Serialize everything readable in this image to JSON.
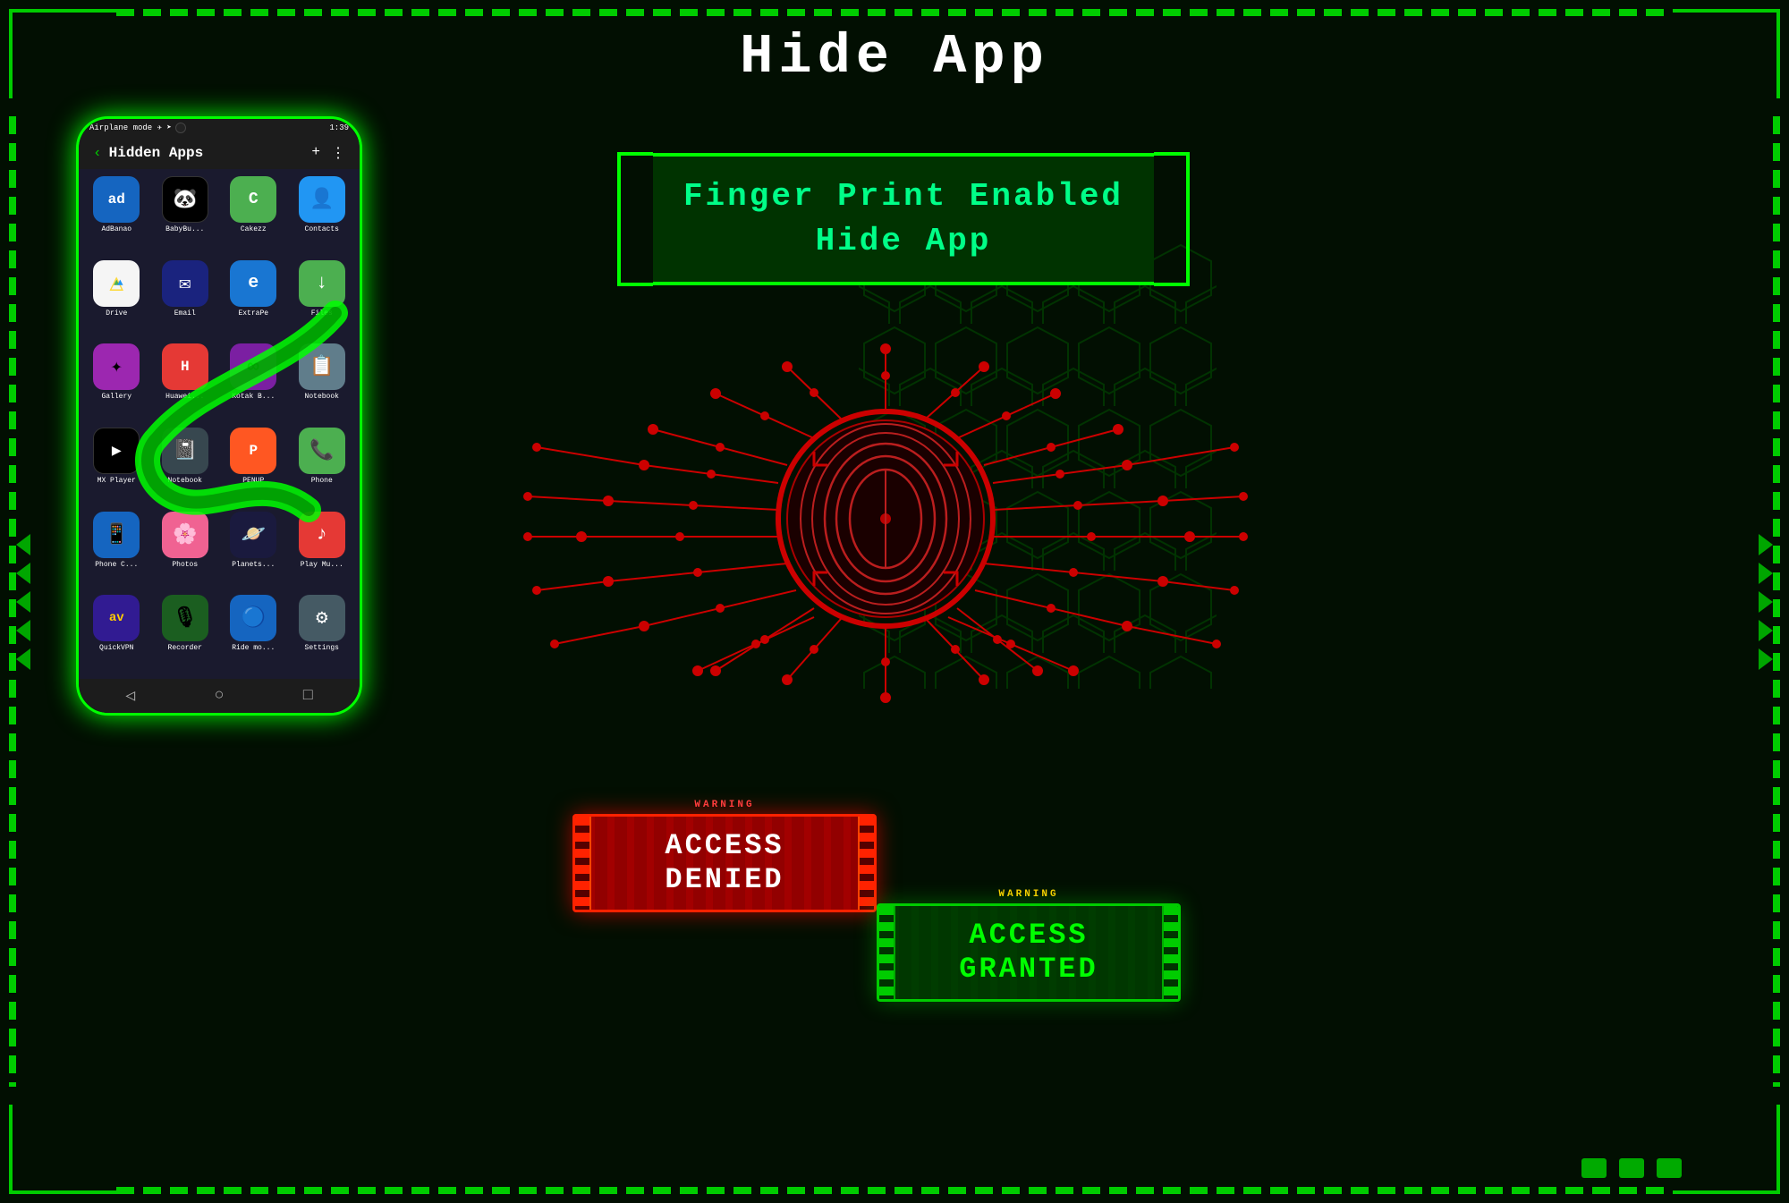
{
  "page": {
    "title": "Hide App",
    "background_color": "#020f02"
  },
  "phone": {
    "status_bar": {
      "left_text": "Airplane mode ✈ ➤",
      "right_text": "1:39"
    },
    "nav": {
      "back": "‹",
      "title": "Hidden Apps",
      "add": "+",
      "more": "⋮"
    },
    "apps": [
      {
        "label": "AdBanao",
        "color": "#1565C0",
        "text": "ad"
      },
      {
        "label": "BabyBu...",
        "color": "#000000",
        "text": "🐼"
      },
      {
        "label": "Cakezz",
        "color": "#4CAF50",
        "text": "C"
      },
      {
        "label": "Contacts",
        "color": "#2196F3",
        "text": "👤"
      },
      {
        "label": "Drive",
        "color": "#FDD835",
        "text": "△"
      },
      {
        "label": "Email",
        "color": "#1a237e",
        "text": "✉"
      },
      {
        "label": "ExtraPe",
        "color": "#1976D2",
        "text": "e"
      },
      {
        "label": "Files",
        "color": "#4CAF50",
        "text": "↓"
      },
      {
        "label": "Gallery",
        "color": "#9C27B0",
        "text": "✦"
      },
      {
        "label": "Huawei...",
        "color": "#E53935",
        "text": "H"
      },
      {
        "label": "Kotak B...",
        "color": "#E53935",
        "text": "K"
      },
      {
        "label": "Notebook",
        "color": "#607D8B",
        "text": "📋"
      },
      {
        "label": "MX Player",
        "color": "#000000",
        "text": "▶"
      },
      {
        "label": "Notebook",
        "color": "#37474F",
        "text": "📓"
      },
      {
        "label": "PENUP",
        "color": "#FF5722",
        "text": "P"
      },
      {
        "label": "Phone",
        "color": "#4CAF50",
        "text": "📞"
      },
      {
        "label": "Phone C...",
        "color": "#1565C0",
        "text": "📱"
      },
      {
        "label": "Photos",
        "color": "#F06292",
        "text": "🌸"
      },
      {
        "label": "Planets...",
        "color": "#1a1a3e",
        "text": "🪐"
      },
      {
        "label": "Play Mu...",
        "color": "#E53935",
        "text": "♪"
      },
      {
        "label": "QuickVPN",
        "color": "#311B92",
        "text": "av"
      },
      {
        "label": "Recorder",
        "color": "#1B5E20",
        "text": "🎙"
      },
      {
        "label": "Ride mo...",
        "color": "#1565C0",
        "text": "🔵"
      },
      {
        "label": "Settings",
        "color": "#455A64",
        "text": "⚙"
      }
    ]
  },
  "fingerprint": {
    "title_line1": "Finger Print Enabled",
    "title_line2": "Hide App"
  },
  "access_denied": {
    "warning": "WARNING",
    "text_line1": "ACCESS",
    "text_line2": "DENIED"
  },
  "access_granted": {
    "warning": "WARNING",
    "text_line1": "ACCESS",
    "text_line2": "GRANTED"
  },
  "icons": {
    "back_arrow": "‹",
    "add": "+",
    "more": "⋮",
    "nav_back": "◁",
    "nav_home": "○",
    "nav_recent": "□"
  }
}
